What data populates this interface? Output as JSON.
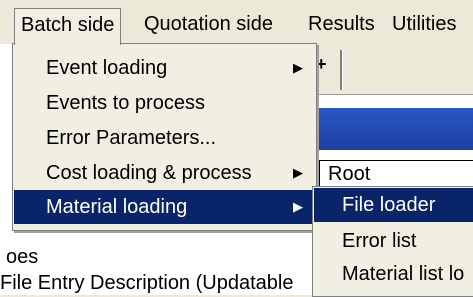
{
  "menubar": {
    "items": [
      "Batch side",
      "Quotation side",
      "Results",
      "Utilities"
    ]
  },
  "batch_menu": {
    "items": [
      {
        "label": "Event loading",
        "has_submenu": true
      },
      {
        "label": "Events to process",
        "has_submenu": false
      },
      {
        "label": "Error Parameters...",
        "has_submenu": false
      },
      {
        "label": "Cost loading & process",
        "has_submenu": true
      },
      {
        "label": "Material loading",
        "has_submenu": true,
        "selected": true
      }
    ],
    "arrow_glyph": "▶"
  },
  "material_submenu": {
    "items": [
      {
        "label": "File loader",
        "selected": true
      },
      {
        "label": "Error list"
      },
      {
        "label": "Material list lo"
      }
    ]
  },
  "background": {
    "toolbar_plus": "+",
    "tree_root": "Root",
    "text_line1": "oes",
    "text_line2": "File Entry Description (Updatable"
  },
  "colors": {
    "menu_bg": "#f1efe2",
    "highlight": "#0a246a",
    "title_band": "#2a56c6"
  }
}
